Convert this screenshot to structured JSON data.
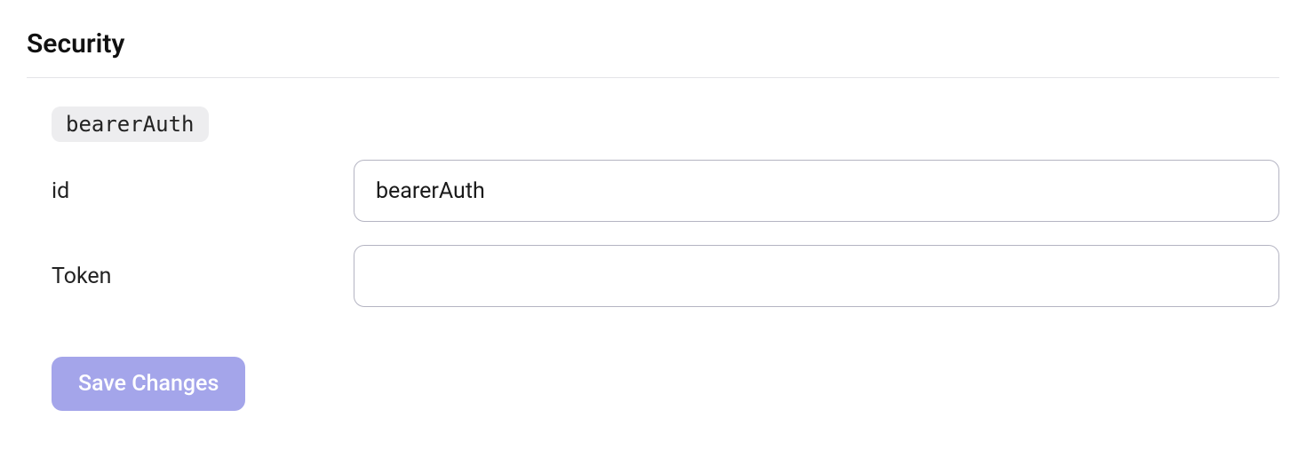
{
  "section": {
    "heading": "Security"
  },
  "schemeBadge": "bearerAuth",
  "fields": {
    "id": {
      "label": "id",
      "value": "bearerAuth"
    },
    "token": {
      "label": "Token",
      "value": ""
    }
  },
  "actions": {
    "save_label": "Save Changes"
  }
}
